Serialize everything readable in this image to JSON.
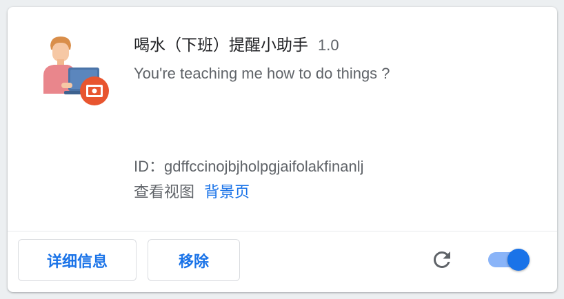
{
  "extension": {
    "name": "喝水（下班）提醒小助手",
    "version": "1.0",
    "description": "You're teaching me how to do things ?",
    "id_label": "ID：",
    "id": "gdffccinojbjholpgjaifolakfinanlj",
    "views_label": "查看视图",
    "views_link": "背景页",
    "enabled": true
  },
  "buttons": {
    "details": "详细信息",
    "remove": "移除"
  },
  "colors": {
    "accent": "#1a73e8",
    "toggle_track": "#8ab4f8",
    "badge": "#e8552f"
  },
  "icons": {
    "extension": "person-laptop-video-icon",
    "reload": "reload-icon"
  }
}
